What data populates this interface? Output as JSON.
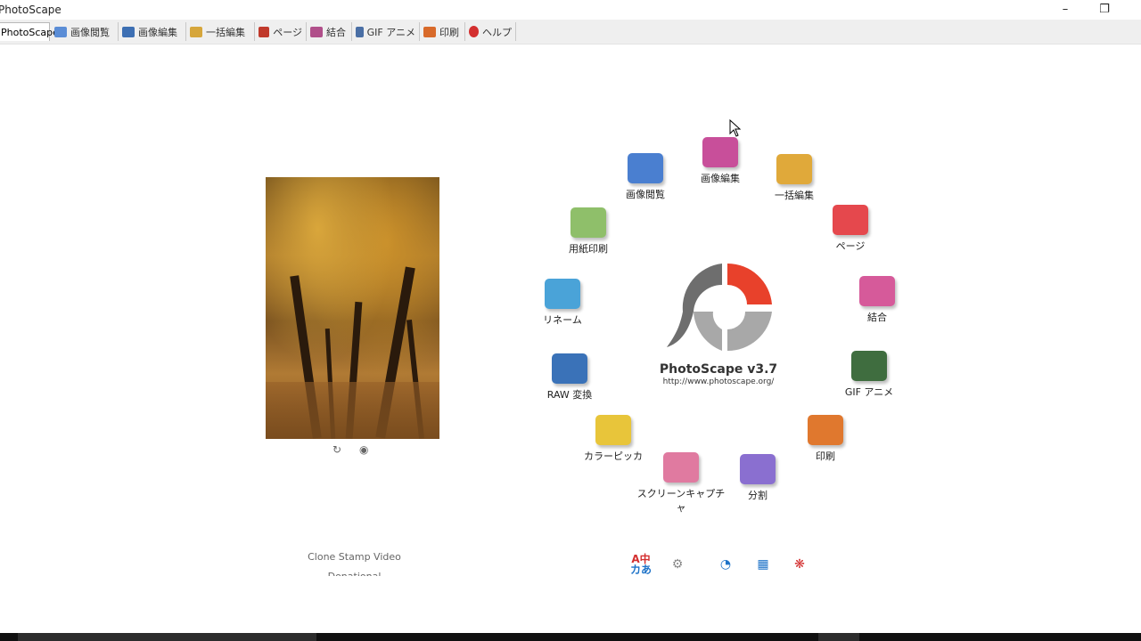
{
  "window": {
    "title": "PhotoScape"
  },
  "tabs": [
    {
      "label": "PhotoScape",
      "active": true
    },
    {
      "label": "画像閲覧",
      "icon": "viewer-icon",
      "color": "#5b8dd6"
    },
    {
      "label": "画像編集",
      "icon": "editor-icon",
      "color": "#3d6fb3"
    },
    {
      "label": "一括編集",
      "icon": "batch-icon",
      "color": "#d6a63b"
    },
    {
      "label": "ページ",
      "icon": "page-icon",
      "color": "#c0392b"
    },
    {
      "label": "結合",
      "icon": "combine-icon",
      "color": "#b04f8a"
    },
    {
      "label": "GIF アニメ",
      "icon": "gif-icon",
      "color": "#4a6fa5"
    },
    {
      "label": "印刷",
      "icon": "print-icon",
      "color": "#d86a2a"
    },
    {
      "label": "ヘルプ",
      "icon": "help-icon",
      "color": "#d32f2f"
    }
  ],
  "hub": {
    "product": "PhotoScape v3.7",
    "url": "http://www.photoscape.org/",
    "items": [
      {
        "label": "画像閲覧",
        "icon": "viewer-icon",
        "color": "#4a7fd0"
      },
      {
        "label": "画像編集",
        "icon": "editor-icon",
        "color": "#c84f9a"
      },
      {
        "label": "一括編集",
        "icon": "batch-icon",
        "color": "#e0a93a"
      },
      {
        "label": "ページ",
        "icon": "page-icon",
        "color": "#e5484d"
      },
      {
        "label": "結合",
        "icon": "combine-icon",
        "color": "#d65a9a"
      },
      {
        "label": "GIF アニメ",
        "icon": "gif-icon",
        "color": "#3f6d3f"
      },
      {
        "label": "印刷",
        "icon": "print-icon",
        "color": "#e0782e"
      },
      {
        "label": "分割",
        "icon": "split-icon",
        "color": "#8a6fd0"
      },
      {
        "label": "スクリーンキャプチャ",
        "icon": "screen-capture-icon",
        "color": "#e07aa0"
      },
      {
        "label": "カラーピッカ",
        "icon": "color-picker-icon",
        "color": "#e8c53a"
      },
      {
        "label": "RAW 変換",
        "icon": "raw-icon",
        "color": "#3a72b8"
      },
      {
        "label": "リネーム",
        "icon": "rename-icon",
        "color": "#4aa3d8"
      },
      {
        "label": "用紙印刷",
        "icon": "paper-print-icon",
        "color": "#8fbf6a"
      }
    ]
  },
  "preview": {
    "links_line1": "Clone Stamp  Video",
    "links_line2": "Donational"
  },
  "tools": [
    {
      "icon": "language-icon",
      "text": "A中\nカあ",
      "color": "#d32f2f"
    },
    {
      "icon": "wrench-icon",
      "text": "",
      "color": "#888888"
    },
    {
      "icon": "photoscape-x-icon",
      "text": "",
      "color": "#1e73c8"
    },
    {
      "icon": "puzzle-icon",
      "text": "",
      "color": "#1e73c8"
    },
    {
      "icon": "maple-icon",
      "text": "",
      "color": "#d32f2f"
    }
  ],
  "logo_colors": {
    "red": "#e8412b",
    "dark": "#6e6e6e",
    "gray": "#a8a8a8"
  }
}
